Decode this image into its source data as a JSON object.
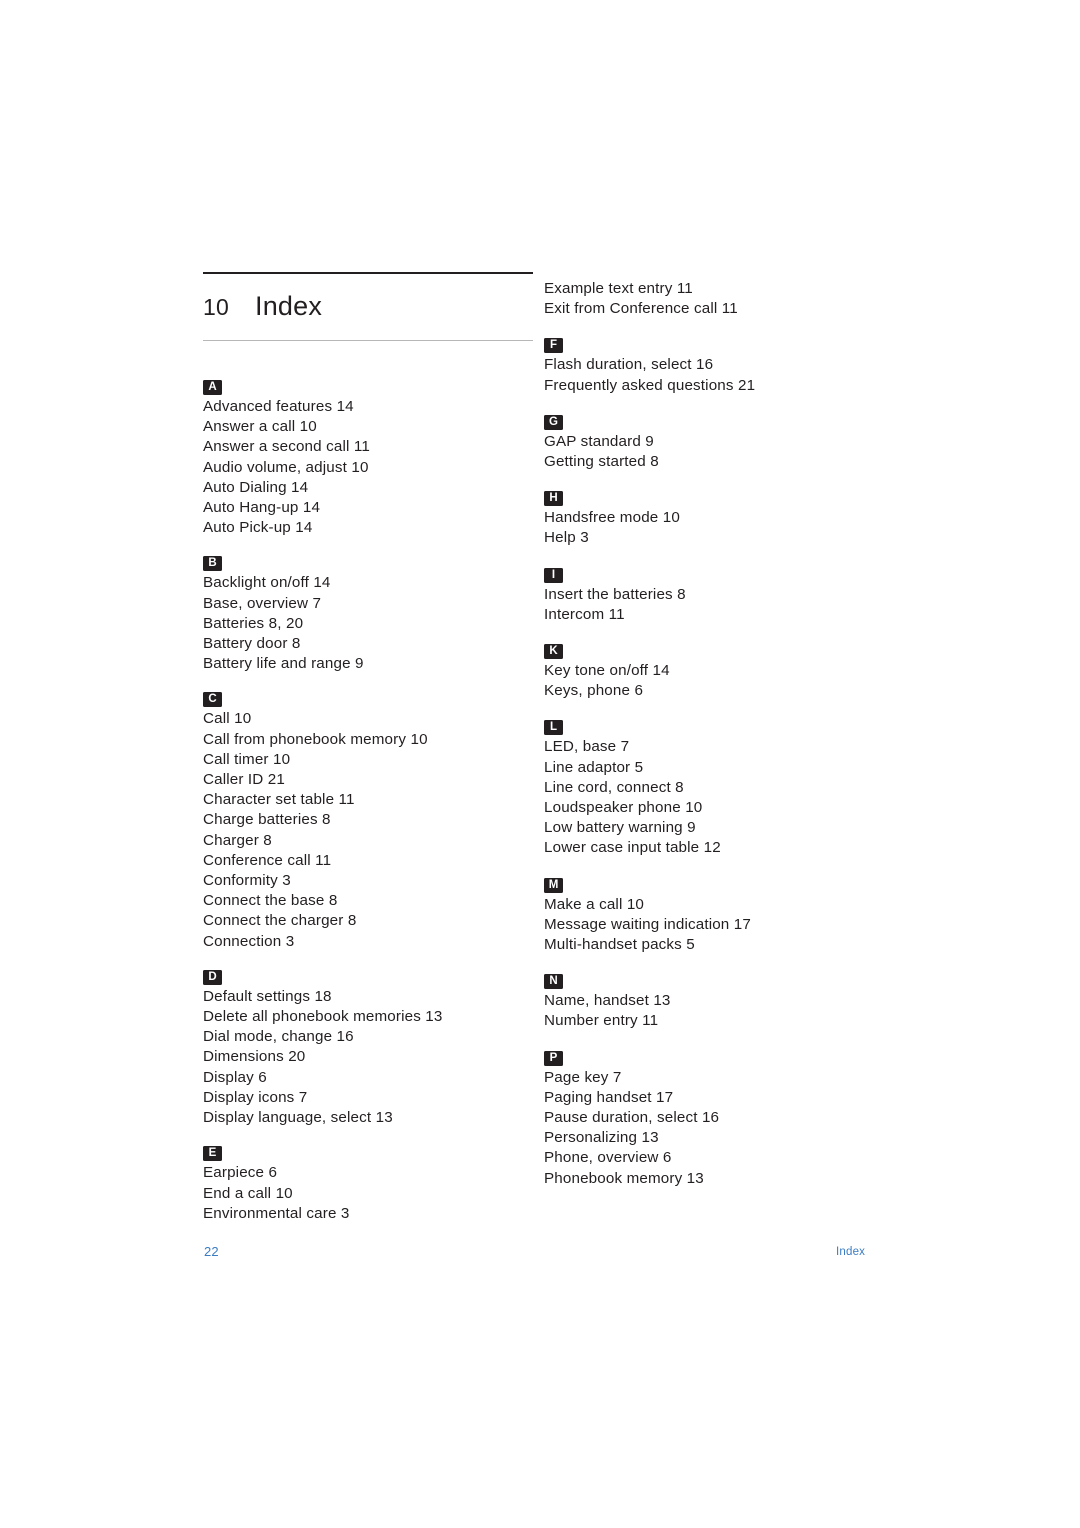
{
  "heading": {
    "number": "10",
    "title": "Index"
  },
  "footer": {
    "page_number": "22",
    "label": "Index",
    "color": "#3b7cc4"
  },
  "columns": {
    "left": [
      {
        "letter": "A",
        "entries": [
          "Advanced features 14",
          "Answer a call 10",
          "Answer a second call 11",
          "Audio volume, adjust 10",
          "Auto Dialing 14",
          "Auto Hang-up 14",
          "Auto Pick-up 14"
        ]
      },
      {
        "letter": "B",
        "entries": [
          "Backlight on/off 14",
          "Base, overview 7",
          "Batteries 8, 20",
          "Battery door 8",
          "Battery life and range 9"
        ]
      },
      {
        "letter": "C",
        "entries": [
          "Call 10",
          "Call from phonebook memory 10",
          "Call timer 10",
          "Caller ID 21",
          "Character set table 11",
          "Charge batteries 8",
          "Charger 8",
          "Conference call 11",
          "Conformity 3",
          "Connect the base 8",
          "Connect the charger 8",
          "Connection 3"
        ]
      },
      {
        "letter": "D",
        "entries": [
          "Default settings 18",
          "Delete all phonebook memories 13",
          "Dial mode, change 16",
          "Dimensions 20",
          "Display 6",
          "Display icons 7",
          "Display language, select 13"
        ]
      },
      {
        "letter": "E",
        "entries": [
          "Earpiece 6",
          "End a call 10",
          "Environmental care 3"
        ]
      }
    ],
    "right": [
      {
        "letter": "",
        "entries": [
          "Example text entry 11",
          "Exit from Conference call 11"
        ]
      },
      {
        "letter": "F",
        "entries": [
          "Flash duration, select 16",
          "Frequently asked questions 21"
        ]
      },
      {
        "letter": "G",
        "entries": [
          "GAP standard 9",
          "Getting started 8"
        ]
      },
      {
        "letter": "H",
        "entries": [
          "Handsfree mode 10",
          "Help 3"
        ]
      },
      {
        "letter": "I",
        "entries": [
          "Insert the batteries 8",
          "Intercom 11"
        ]
      },
      {
        "letter": "K",
        "entries": [
          "Key tone on/off 14",
          "Keys, phone 6"
        ]
      },
      {
        "letter": "L",
        "entries": [
          "LED, base 7",
          "Line adaptor 5",
          "Line cord, connect 8",
          "Loudspeaker phone 10",
          "Low battery warning 9",
          "Lower case input table 12"
        ]
      },
      {
        "letter": "M",
        "entries": [
          "Make a call 10",
          "Message waiting indication 17",
          "Multi-handset packs 5"
        ]
      },
      {
        "letter": "N",
        "entries": [
          "Name, handset 13",
          "Number entry 11"
        ]
      },
      {
        "letter": "P",
        "entries": [
          "Page key 7",
          "Paging handset 17",
          "Pause duration, select 16",
          "Personalizing 13",
          "Phone, overview 6",
          "Phonebook memory 13"
        ]
      }
    ]
  }
}
